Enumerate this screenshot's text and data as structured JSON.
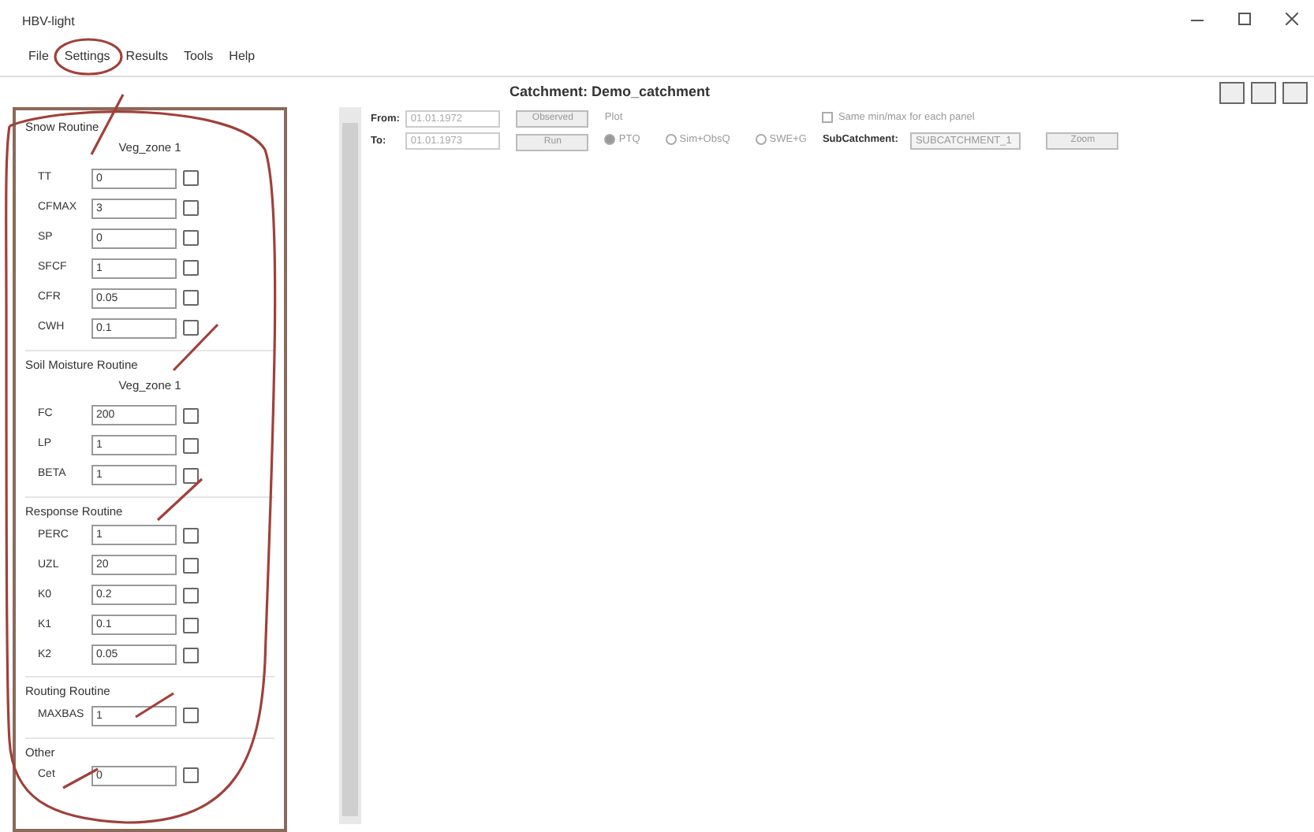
{
  "window": {
    "title": "HBV-light"
  },
  "menu": [
    "File",
    "Settings",
    "Results",
    "Tools",
    "Help"
  ],
  "header": {
    "catchment": "Catchment: Demo_catchment"
  },
  "panel": {
    "groups": [
      {
        "title": "Snow Routine",
        "zone": "Veg_zone 1",
        "params": [
          {
            "name": "TT",
            "value": "0",
            "checked": false
          },
          {
            "name": "CFMAX",
            "value": "3",
            "checked": false
          },
          {
            "name": "SP",
            "value": "0",
            "checked": false
          },
          {
            "name": "SFCF",
            "value": "1",
            "checked": false
          },
          {
            "name": "CFR",
            "value": "0.05",
            "checked": false
          },
          {
            "name": "CWH",
            "value": "0.1",
            "checked": false
          }
        ]
      },
      {
        "title": "Soil Moisture Routine",
        "zone": "Veg_zone 1",
        "params": [
          {
            "name": "FC",
            "value": "200",
            "checked": false
          },
          {
            "name": "LP",
            "value": "1",
            "checked": false
          },
          {
            "name": "BETA",
            "value": "1",
            "checked": false
          }
        ]
      },
      {
        "title": "Response Routine",
        "params": [
          {
            "name": "PERC",
            "value": "1",
            "checked": false
          },
          {
            "name": "UZL",
            "value": "20",
            "checked": false
          },
          {
            "name": "K0",
            "value": "0.2",
            "checked": false
          },
          {
            "name": "K1",
            "value": "0.1",
            "checked": false
          },
          {
            "name": "K2",
            "value": "0.05",
            "checked": false
          }
        ]
      },
      {
        "title": "Routing Routine",
        "params": [
          {
            "name": "MAXBAS",
            "value": "1",
            "checked": false
          }
        ]
      },
      {
        "title": "Other",
        "params": [
          {
            "name": "Cet",
            "value": "0",
            "checked": false
          }
        ]
      }
    ]
  },
  "toolbar": {
    "from_label": "From:",
    "from_value": "01.01.1972",
    "to_label": "To:",
    "to_value": "01.01.1973",
    "buttons": [
      "Observed",
      "Run"
    ],
    "plot_label": "Plot",
    "radios": [
      {
        "label": "PTQ",
        "selected": true
      },
      {
        "label": "Sim+ObsQ",
        "selected": false
      },
      {
        "label": "SWE+G",
        "selected": false
      }
    ],
    "same_scale": {
      "label": "Same min/max for each panel",
      "checked": false
    },
    "subcatchment_label": "SubCatchment:",
    "subcatchment_value": "SUBCATCHMENT_1",
    "zoom_button": "Zoom"
  }
}
